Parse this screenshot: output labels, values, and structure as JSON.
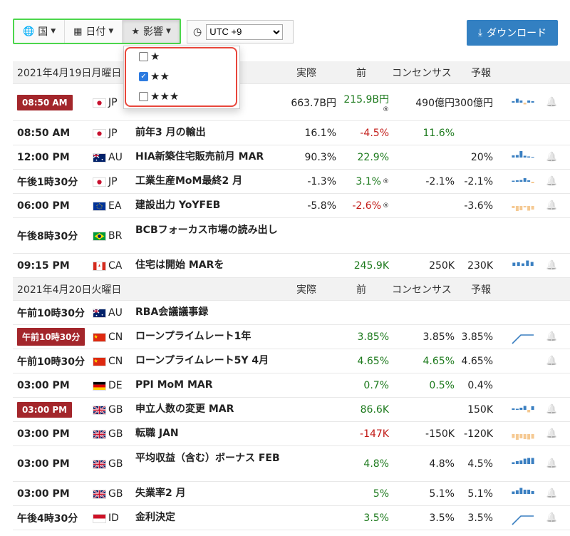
{
  "toolbar": {
    "country_label": "国",
    "date_label": "日付",
    "impact_label": "影響",
    "timezone_value": "UTC +9",
    "download_label": "ダウンロード"
  },
  "impact_dropdown": {
    "options": [
      {
        "label": "★",
        "checked": false
      },
      {
        "label": "★★",
        "checked": true
      },
      {
        "label": "★★★",
        "checked": false
      }
    ]
  },
  "columns": {
    "actual": "実際",
    "previous": "前",
    "consensus": "コンセンサス",
    "forecast": "予報"
  },
  "days": [
    {
      "label": "2021年4月19日月曜日"
    },
    {
      "label": "2021年4月20日火曜日"
    }
  ],
  "events": [
    {
      "time": "08:50 AM",
      "badge": true,
      "flag": "jp",
      "country": "JP",
      "name": "",
      "actual": "663.7B円",
      "previous": "215.9B円",
      "prev_color": "green",
      "revised": "®",
      "consensus": "490億円",
      "cons_color": "",
      "forecast": "300億円",
      "spark": [
        0.2,
        0.55,
        0.3,
        -0.25,
        0.3,
        0.2
      ],
      "bell": true
    },
    {
      "time": "08:50 AM",
      "badge": false,
      "flag": "jp",
      "country": "JP",
      "name": "前年3 月の輸出",
      "actual": "16.1%",
      "previous": "-4.5%",
      "prev_color": "red",
      "revised": "",
      "consensus": "11.6%",
      "cons_color": "green",
      "forecast": "",
      "spark": [],
      "bell": false
    },
    {
      "time": "12:00 PM",
      "badge": false,
      "flag": "au",
      "country": "AU",
      "name": "HIA新築住宅販売前月 MAR",
      "actual": "90.3%",
      "previous": "22.9%",
      "prev_color": "green",
      "revised": "",
      "consensus": "",
      "cons_color": "",
      "forecast": "20%",
      "spark": [
        0.3,
        0.35,
        0.9,
        0.25,
        0.15,
        0.1
      ],
      "bell": true
    },
    {
      "time": "午後1時30分",
      "badge": false,
      "flag": "jp",
      "country": "JP",
      "name": "工業生産MoM最終2 月",
      "actual": "-1.3%",
      "previous": "3.1%",
      "prev_color": "green",
      "revised": "®",
      "consensus": "-2.1%",
      "cons_color": "",
      "forecast": "-2.1%",
      "spark": [
        0.15,
        0.2,
        0.25,
        0.5,
        0.2,
        -0.2
      ],
      "bell": true
    },
    {
      "time": "06:00 PM",
      "badge": false,
      "flag": "ea",
      "country": "EA",
      "name": "建設出力 YoYFEB",
      "actual": "-5.8%",
      "previous": "-2.6%",
      "prev_color": "red",
      "revised": "®",
      "consensus": "",
      "cons_color": "",
      "forecast": "-3.6%",
      "spark": [
        -0.3,
        -0.7,
        -0.6,
        -0.2,
        -0.65,
        -0.5
      ],
      "bell": true
    },
    {
      "time": "午後8時30分",
      "badge": false,
      "flag": "br",
      "country": "BR",
      "name": "BCBフォーカス市場の読み出し",
      "actual": "",
      "previous": "",
      "prev_color": "",
      "revised": "",
      "consensus": "",
      "cons_color": "",
      "forecast": "",
      "spark": [],
      "bell": false
    },
    {
      "time": "09:15 PM",
      "badge": false,
      "flag": "ca",
      "country": "CA",
      "name": "住宅は開始 MARを",
      "actual": "",
      "previous": "245.9K",
      "prev_color": "green",
      "revised": "",
      "consensus": "250K",
      "cons_color": "",
      "forecast": "230K",
      "spark": [
        0.45,
        0.5,
        0.35,
        0.75,
        0.55
      ],
      "bell": true
    },
    {
      "time": "午前10時30分",
      "badge": false,
      "flag": "au",
      "country": "AU",
      "name": "RBA会議議事録",
      "actual": "",
      "previous": "",
      "prev_color": "",
      "revised": "",
      "consensus": "",
      "cons_color": "",
      "forecast": "",
      "spark": [],
      "bell": false
    },
    {
      "time": "午前10時30分",
      "badge": true,
      "flag": "cn",
      "country": "CN",
      "name": "ローンプライムレート1年",
      "actual": "",
      "previous": "3.85%",
      "prev_color": "green",
      "revised": "",
      "consensus": "3.85%",
      "cons_color": "",
      "forecast": "3.85%",
      "spark": "line",
      "bell": true
    },
    {
      "time": "午前10時30分",
      "badge": false,
      "flag": "cn",
      "country": "CN",
      "name": "ローンプライムレート5Y 4月",
      "actual": "",
      "previous": "4.65%",
      "prev_color": "green",
      "revised": "",
      "consensus": "4.65%",
      "cons_color": "green",
      "forecast": "4.65%",
      "spark": [],
      "bell": true
    },
    {
      "time": "03:00 PM",
      "badge": false,
      "flag": "de",
      "country": "DE",
      "name": "PPI MoM MAR",
      "actual": "",
      "previous": "0.7%",
      "prev_color": "green",
      "revised": "",
      "consensus": "0.5%",
      "cons_color": "green",
      "forecast": "0.4%",
      "spark": [],
      "bell": false
    },
    {
      "time": "03:00 PM",
      "badge": true,
      "flag": "gb",
      "country": "GB",
      "name": "申立人数の変更 MAR",
      "actual": "",
      "previous": "86.6K",
      "prev_color": "green",
      "revised": "",
      "consensus": "",
      "cons_color": "",
      "forecast": "150K",
      "spark": [
        0.2,
        0.15,
        0.3,
        0.55,
        -0.35,
        0.5
      ],
      "bell": true
    },
    {
      "time": "03:00 PM",
      "badge": false,
      "flag": "gb",
      "country": "GB",
      "name": "転職 JAN",
      "actual": "",
      "previous": "-147K",
      "prev_color": "red",
      "revised": "",
      "consensus": "-150K",
      "cons_color": "",
      "forecast": "-120K",
      "spark": [
        -0.55,
        -0.8,
        -0.6,
        -0.7,
        -0.75,
        -0.65
      ],
      "bell": true
    },
    {
      "time": "03:00 PM",
      "badge": false,
      "flag": "gb",
      "country": "GB",
      "name": "平均収益（含む）ボーナス FEB",
      "actual": "",
      "previous": "4.8%",
      "prev_color": "green",
      "revised": "",
      "consensus": "4.8%",
      "cons_color": "",
      "forecast": "4.5%",
      "spark": [
        0.25,
        0.4,
        0.5,
        0.75,
        0.85,
        0.85
      ],
      "bell": true
    },
    {
      "time": "03:00 PM",
      "badge": false,
      "flag": "gb",
      "country": "GB",
      "name": "失業率2 月",
      "actual": "",
      "previous": "5%",
      "prev_color": "green",
      "revised": "",
      "consensus": "5.1%",
      "cons_color": "",
      "forecast": "5.1%",
      "spark": [
        0.35,
        0.5,
        0.85,
        0.6,
        0.6,
        0.4
      ],
      "bell": true
    },
    {
      "time": "午後4時30分",
      "badge": false,
      "flag": "id",
      "country": "ID",
      "name": "金利決定",
      "actual": "",
      "previous": "3.5%",
      "prev_color": "green",
      "revised": "",
      "consensus": "3.5%",
      "cons_color": "",
      "forecast": "3.5%",
      "spark": "line",
      "bell": true
    }
  ],
  "colors": {
    "accent": "#3380c2",
    "badge": "#a3262b",
    "positive": "#1d7a1d",
    "negative": "#c21b17",
    "highlight_green": "#4cd64c",
    "highlight_red": "#e8463b"
  }
}
